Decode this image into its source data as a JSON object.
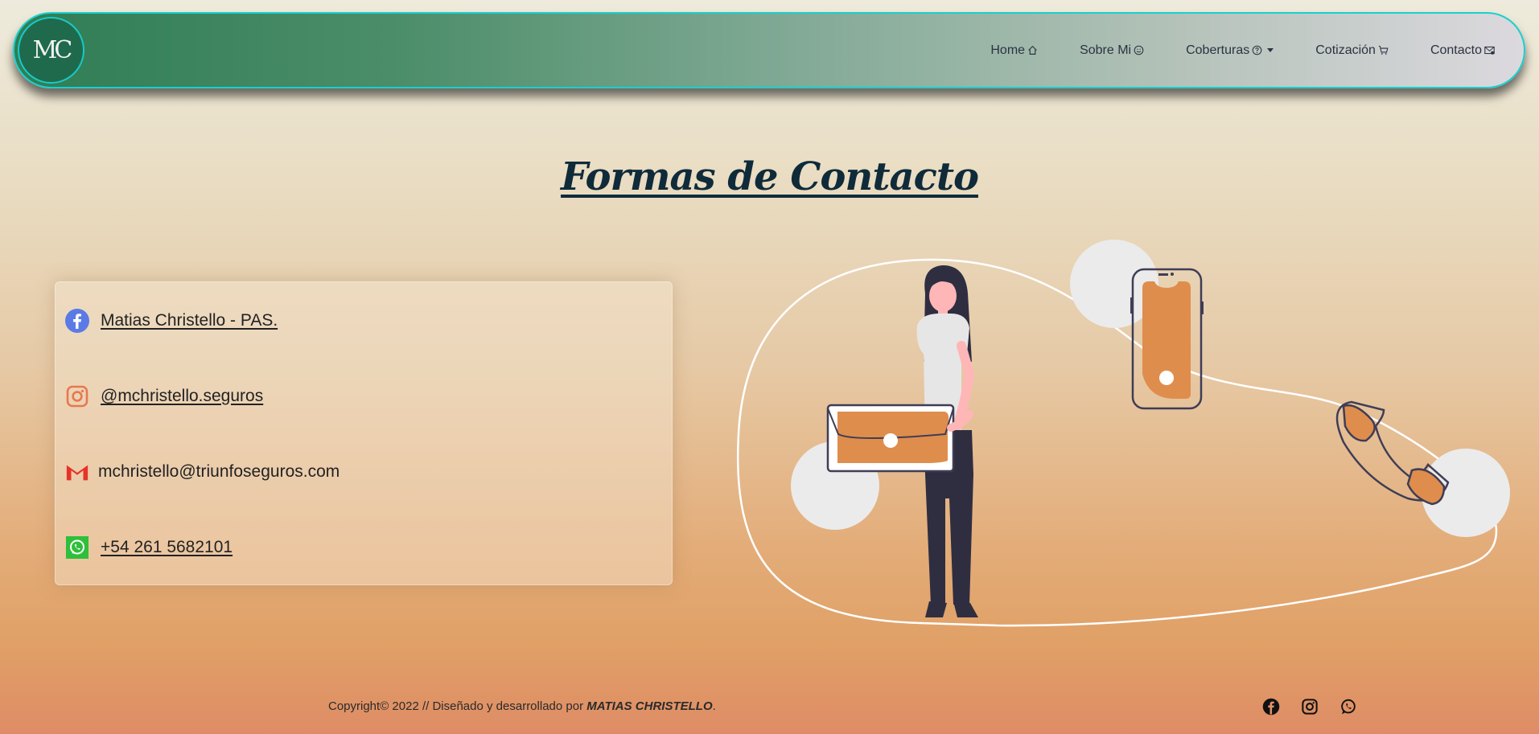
{
  "navbar": {
    "logo_text": "MC",
    "items": [
      {
        "label": "Home",
        "icon": "home-icon"
      },
      {
        "label": "Sobre Mi",
        "icon": "smile-icon"
      },
      {
        "label": "Coberturas",
        "icon": "question-icon",
        "dropdown": true
      },
      {
        "label": "Cotización",
        "icon": "cart-icon"
      },
      {
        "label": "Contacto",
        "icon": "mail-icon"
      }
    ]
  },
  "page": {
    "title": "Formas de Contacto"
  },
  "contacts": [
    {
      "label": "Matias Christello - PAS.",
      "icon": "facebook-icon"
    },
    {
      "label": "@mchristello.seguros",
      "icon": "instagram-icon"
    },
    {
      "label": "mchristello@triunfoseguros.com",
      "icon": "gmail-icon"
    },
    {
      "label": "+54 261 5682101",
      "icon": "whatsapp-icon"
    }
  ],
  "footer": {
    "text": "Copyright© 2022 // Diseñado y desarrollado por ",
    "author": "MATIAS CHRISTELLO",
    "suffix": ".",
    "social_icons": [
      "facebook-icon",
      "instagram-icon",
      "whatsapp-icon"
    ]
  },
  "colors": {
    "accent_border": "#19d0cf",
    "title": "#0f2b3a",
    "illustration_orange": "#df8d4c",
    "illustration_dark": "#2f2e41"
  }
}
